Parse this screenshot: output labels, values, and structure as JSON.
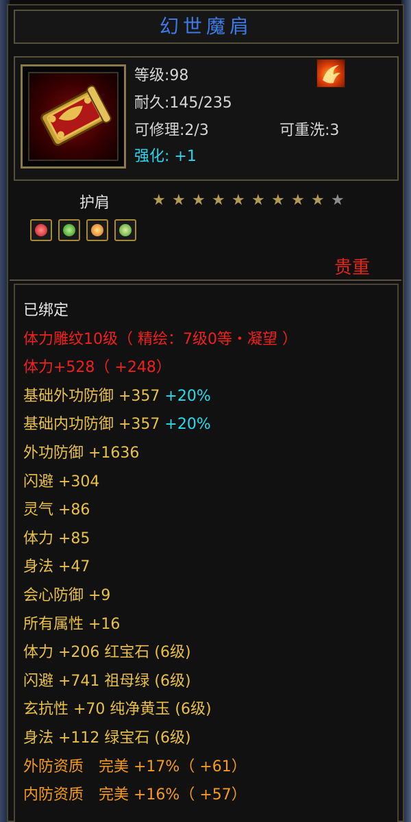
{
  "item": {
    "name": "幻世魔肩",
    "level": "等级:98",
    "durability": "耐久:145/235",
    "repairable": "可修理:2/3",
    "rewashable": "可重洗:3",
    "enhance_label": "强化:",
    "enhance_value": "+1",
    "type": "护肩",
    "stars_filled": 9,
    "stars_total": 10,
    "quality": "贵重",
    "gems": [
      "red-gem-icon",
      "green-gem-icon",
      "orange-gem-icon",
      "green-swirl-gem-icon"
    ]
  },
  "stats": [
    {
      "parts": [
        {
          "t": "已绑定",
          "c": "white"
        }
      ]
    },
    {
      "parts": [
        {
          "t": "体力雕纹10级（ 精绘：7级0等・凝望 ）",
          "c": "red"
        }
      ]
    },
    {
      "parts": [
        {
          "t": "体力+528（ +248）",
          "c": "red"
        }
      ]
    },
    {
      "parts": [
        {
          "t": "基础外功防御 +357 ",
          "c": "yellow"
        },
        {
          "t": "+20%",
          "c": "cyan"
        }
      ]
    },
    {
      "parts": [
        {
          "t": "基础内功防御 +357 ",
          "c": "yellow"
        },
        {
          "t": "+20%",
          "c": "cyan"
        }
      ]
    },
    {
      "parts": [
        {
          "t": "外功防御 +1636",
          "c": "yellow"
        }
      ]
    },
    {
      "parts": [
        {
          "t": "闪避 +304",
          "c": "yellow"
        }
      ]
    },
    {
      "parts": [
        {
          "t": "灵气 +86",
          "c": "yellow"
        }
      ]
    },
    {
      "parts": [
        {
          "t": "体力 +85",
          "c": "yellow"
        }
      ]
    },
    {
      "parts": [
        {
          "t": "身法 +47",
          "c": "yellow"
        }
      ]
    },
    {
      "parts": [
        {
          "t": "会心防御 +9",
          "c": "yellow"
        }
      ]
    },
    {
      "parts": [
        {
          "t": "所有属性 +16",
          "c": "yellow"
        }
      ]
    },
    {
      "parts": [
        {
          "t": "体力 +206 红宝石 (6级)",
          "c": "yellow"
        }
      ]
    },
    {
      "parts": [
        {
          "t": "闪避 +741 祖母绿 (6级)",
          "c": "yellow"
        }
      ]
    },
    {
      "parts": [
        {
          "t": "玄抗性 +70 纯净黄玉 (6级)",
          "c": "yellow"
        }
      ]
    },
    {
      "parts": [
        {
          "t": "身法 +112 绿宝石 (6级)",
          "c": "yellow"
        }
      ]
    },
    {
      "parts": [
        {
          "t": "外防资质　完美 +17%（ +61）",
          "c": "orange"
        }
      ]
    },
    {
      "parts": [
        {
          "t": "内防资质　完美 +16%（ +57）",
          "c": "orange"
        }
      ]
    }
  ],
  "colors": {
    "title": "#3d7be8",
    "enhance": "#29d8f0",
    "quality": "#e0261e",
    "bound": "#e8e8e8",
    "engrave": "#f0211d",
    "stat": "#e8c04a",
    "percent": "#26dcef",
    "aptitude": "#f59b1f"
  }
}
